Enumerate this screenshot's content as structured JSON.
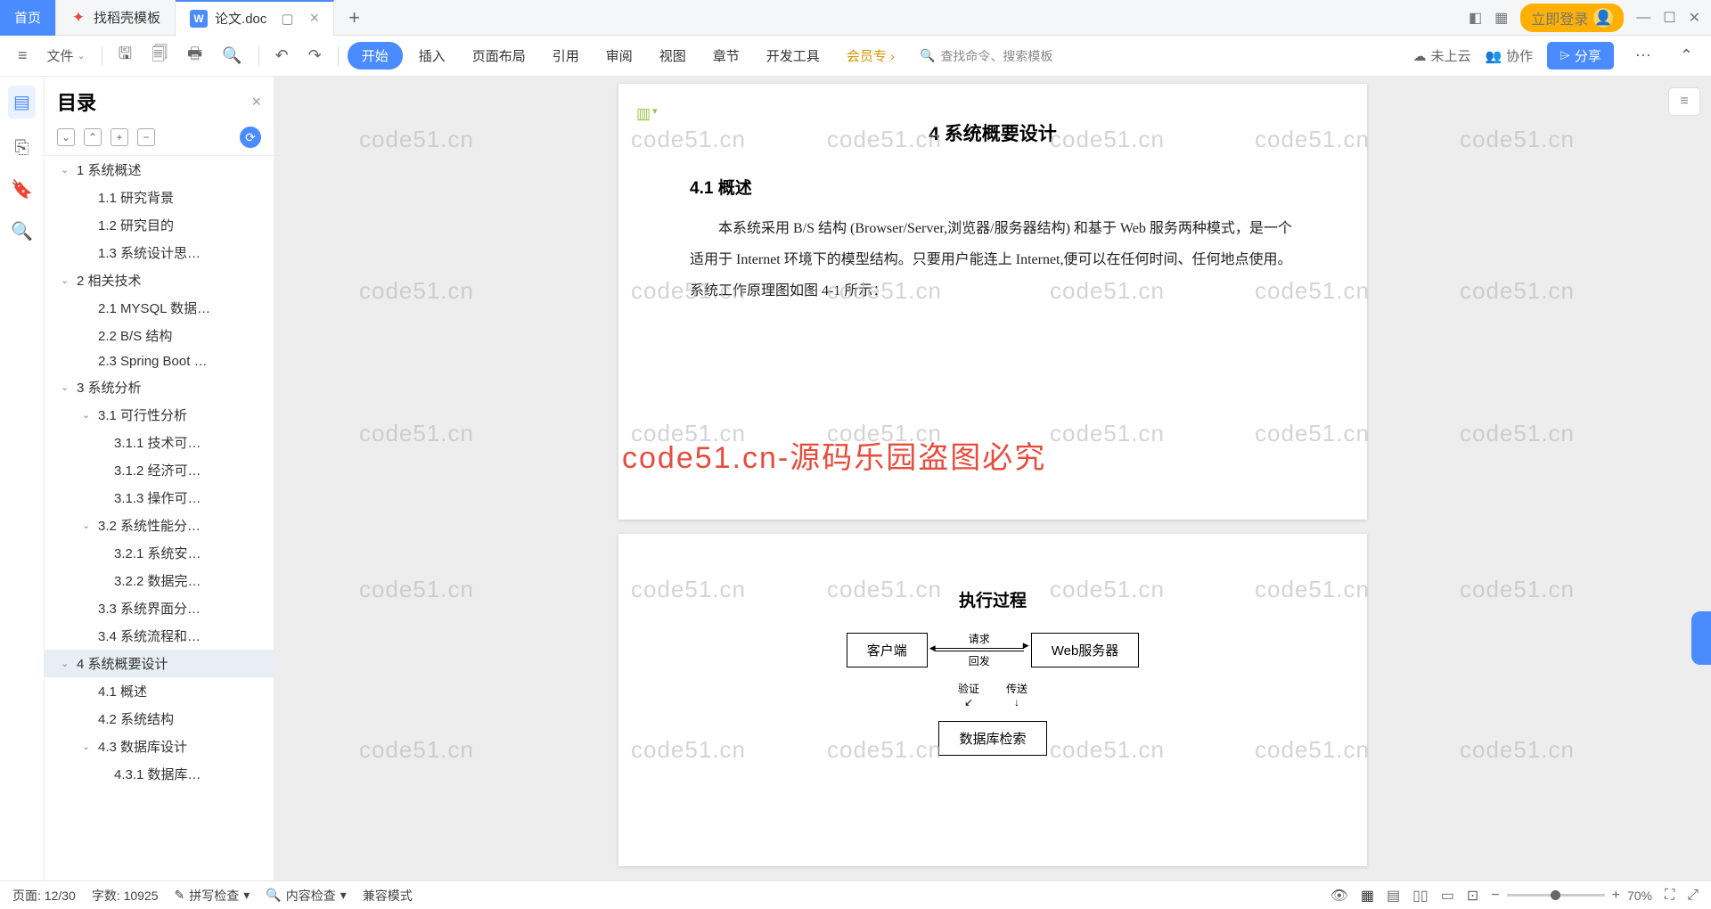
{
  "tabs": {
    "home": "首页",
    "template": "找稻壳模板",
    "doc": "论文.doc"
  },
  "win": {
    "login": "立即登录"
  },
  "toolbar": {
    "file": "文件",
    "ribbon": {
      "start": "开始",
      "insert": "插入",
      "layout": "页面布局",
      "ref": "引用",
      "review": "审阅",
      "view": "视图",
      "chapter": "章节",
      "devtools": "开发工具",
      "member": "会员专"
    },
    "search": "查找命令、搜索模板",
    "cloud": "未上云",
    "collab": "协作",
    "share": "分享"
  },
  "sidebar": {
    "title": "目录",
    "items": [
      {
        "t": "1 系统概述",
        "lv": 1,
        "ch": 1
      },
      {
        "t": "1.1 研究背景",
        "lv": 2
      },
      {
        "t": "1.2 研究目的",
        "lv": 2
      },
      {
        "t": "1.3 系统设计思…",
        "lv": 2
      },
      {
        "t": "2 相关技术",
        "lv": 1,
        "ch": 1
      },
      {
        "t": "2.1 MYSQL 数据…",
        "lv": 2
      },
      {
        "t": "2.2 B/S 结构",
        "lv": 2
      },
      {
        "t": "2.3 Spring Boot …",
        "lv": 2
      },
      {
        "t": "3 系统分析",
        "lv": 1,
        "ch": 1
      },
      {
        "t": "3.1 可行性分析",
        "lv": 2,
        "ch": 1
      },
      {
        "t": "3.1.1 技术可…",
        "lv": 3
      },
      {
        "t": "3.1.2 经济可…",
        "lv": 3
      },
      {
        "t": "3.1.3 操作可…",
        "lv": 3
      },
      {
        "t": "3.2 系统性能分…",
        "lv": 2,
        "ch": 1
      },
      {
        "t": "3.2.1 系统安…",
        "lv": 3
      },
      {
        "t": "3.2.2 数据完…",
        "lv": 3
      },
      {
        "t": "3.3 系统界面分…",
        "lv": 2
      },
      {
        "t": "3.4 系统流程和…",
        "lv": 2
      },
      {
        "t": "4 系统概要设计",
        "lv": 1,
        "ch": 1,
        "sel": 1
      },
      {
        "t": "4.1 概述",
        "lv": 2
      },
      {
        "t": "4.2 系统结构",
        "lv": 2
      },
      {
        "t": "4.3 数据库设计",
        "lv": 2,
        "ch": 1
      },
      {
        "t": "4.3.1 数据库…",
        "lv": 3
      }
    ]
  },
  "doc": {
    "chapter": "4 系统概要设计",
    "s41": "4.1 概述",
    "para": "本系统采用 B/S 结构 (Browser/Server,浏览器/服务器结构) 和基于 Web 服务两种模式，是一个适用于 Internet 环境下的模型结构。只要用户能连上 Internet,便可以在任何时间、任何地点使用。系统工作原理图如图 4-1 所示：",
    "fig_title": "执行过程",
    "box_client": "客户端",
    "box_web": "Web服务器",
    "box_db": "数据库检索",
    "lbl_req": "请求",
    "lbl_ret": "回发",
    "lbl_ver": "验证",
    "lbl_send": "传送"
  },
  "watermark": {
    "grey": "code51.cn",
    "red": "code51.cn-源码乐园盗图必究"
  },
  "status": {
    "page": "页面: 12/30",
    "words": "字数: 10925",
    "spell": "拼写检查",
    "content": "内容检查",
    "compat": "兼容模式",
    "zoom": "70%"
  }
}
